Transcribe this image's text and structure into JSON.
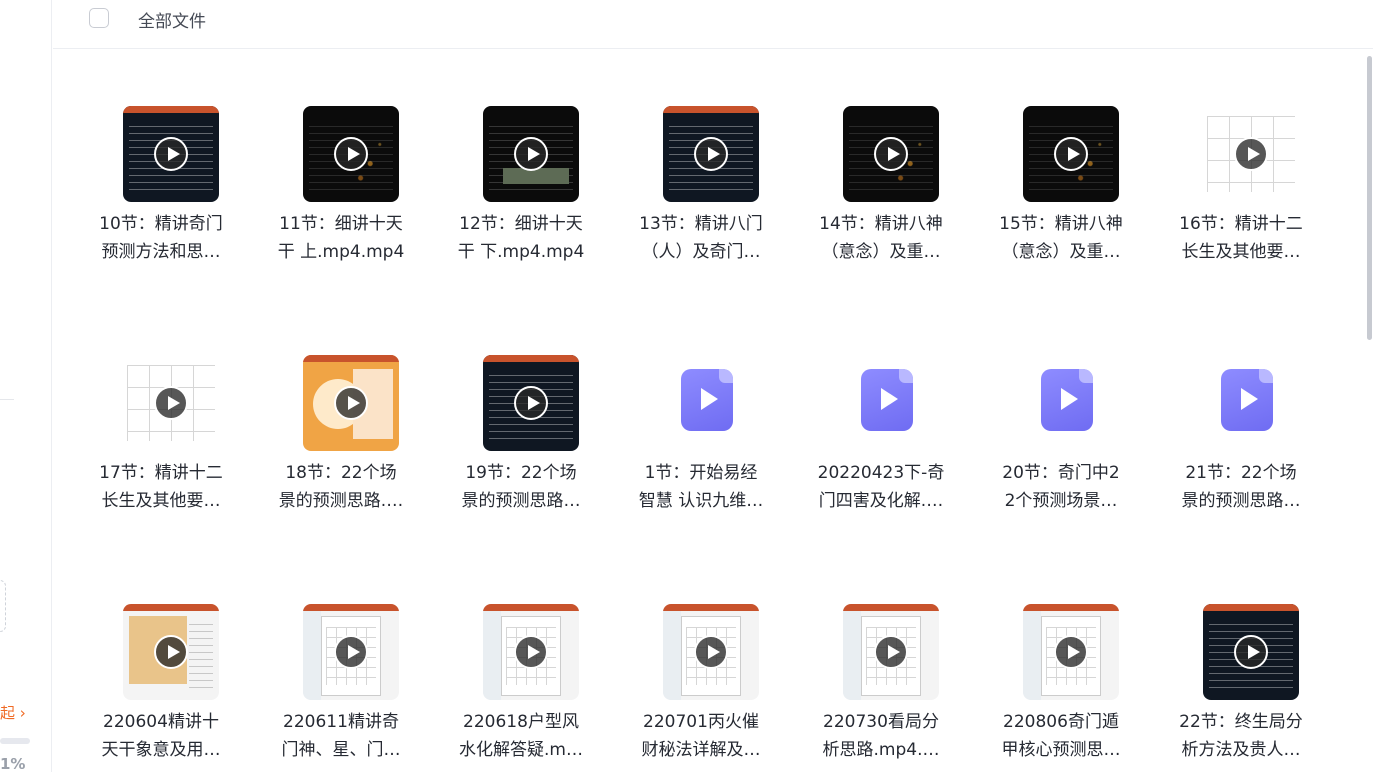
{
  "sidebar": {
    "collapse_label": "起",
    "usage_percent_label": "1%"
  },
  "header": {
    "title": "全部文件"
  },
  "files": [
    {
      "line1": "10节：精讲奇门",
      "line2": "预测方法和思…",
      "thumb": "ppt-dark"
    },
    {
      "line1": "11节：细讲十天",
      "line2": "干 上.mp4.mp4",
      "thumb": "dark"
    },
    {
      "line1": "12节：细讲十天",
      "line2": "干 下.mp4.mp4",
      "thumb": "dark-road"
    },
    {
      "line1": "13节：精讲八门",
      "line2": "（人）及奇门…",
      "thumb": "ppt-dark"
    },
    {
      "line1": "14节：精讲八神",
      "line2": "（意念）及重…",
      "thumb": "dark"
    },
    {
      "line1": "15节：精讲八神",
      "line2": "（意念）及重…",
      "thumb": "dark"
    },
    {
      "line1": "16节：精讲十二",
      "line2": "长生及其他要…",
      "thumb": "grid"
    },
    {
      "line1": "17节：精讲十二",
      "line2": "长生及其他要…",
      "thumb": "grid"
    },
    {
      "line1": "18节：22个场",
      "line2": "景的预测思路.…",
      "thumb": "orange"
    },
    {
      "line1": "19节：22个场",
      "line2": "景的预测思路…",
      "thumb": "ppt-dark"
    },
    {
      "line1": "1节：开始易经",
      "line2": "智慧 认识九维…",
      "thumb": "video-file"
    },
    {
      "line1": "20220423下-奇",
      "line2": "门四害及化解.…",
      "thumb": "video-file"
    },
    {
      "line1": "20节：奇门中2",
      "line2": "2个预测场景…",
      "thumb": "video-file"
    },
    {
      "line1": "21节：22个场",
      "line2": "景的预测思路…",
      "thumb": "video-file"
    },
    {
      "line1": "220604精讲十",
      "line2": "天干象意及用…",
      "thumb": "ppt-orange"
    },
    {
      "line1": "220611精讲奇",
      "line2": "门神、星、门…",
      "thumb": "ppt-light"
    },
    {
      "line1": "220618户型风",
      "line2": "水化解答疑.m…",
      "thumb": "ppt-light"
    },
    {
      "line1": "220701丙火催",
      "line2": "财秘法详解及…",
      "thumb": "ppt-light"
    },
    {
      "line1": "220730看局分",
      "line2": "析思路.mp4.…",
      "thumb": "ppt-light"
    },
    {
      "line1": "220806奇门遁",
      "line2": "甲核心预测思…",
      "thumb": "ppt-light"
    },
    {
      "line1": "22节：终生局分",
      "line2": "析方法及贵人…",
      "thumb": "ppt-dark"
    }
  ]
}
